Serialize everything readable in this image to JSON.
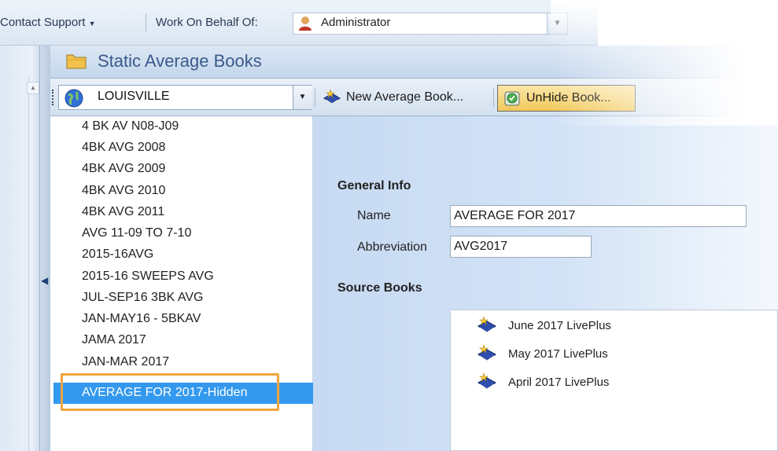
{
  "menu": {
    "contact_support": "Contact Support",
    "work_on_behalf_of": "Work On Behalf Of:",
    "user": "Administrator"
  },
  "header": {
    "title": "Static Average Books"
  },
  "toolbar": {
    "station": "LOUISVILLE",
    "new_book": "New Average Book...",
    "unhide_book": "UnHide Book..."
  },
  "book_list": [
    "4 BK AV N08-J09",
    "4BK AVG 2008",
    "4BK AVG 2009",
    "4BK AVG 2010",
    "4BK AVG 2011",
    "AVG 11-09 TO 7-10",
    "2015-16AVG",
    "2015-16 SWEEPS AVG",
    "JUL-SEP16 3BK AVG",
    "JAN-MAY16 - 5BKAV",
    "JAMA 2017",
    "JAN-MAR 2017",
    "AVERAGE FOR 2017-Hidden"
  ],
  "general_info": {
    "heading": "General Info",
    "name_label": "Name",
    "name_value": "AVERAGE FOR 2017",
    "abbr_label": "Abbreviation",
    "abbr_value": "AVG2017"
  },
  "source_books": {
    "heading": "Source Books",
    "items": [
      "June 2017 LivePlus",
      "May 2017 LivePlus",
      "April 2017 LivePlus"
    ]
  },
  "colors": {
    "selection": "#3399ee",
    "highlight": "#f0a43c"
  }
}
